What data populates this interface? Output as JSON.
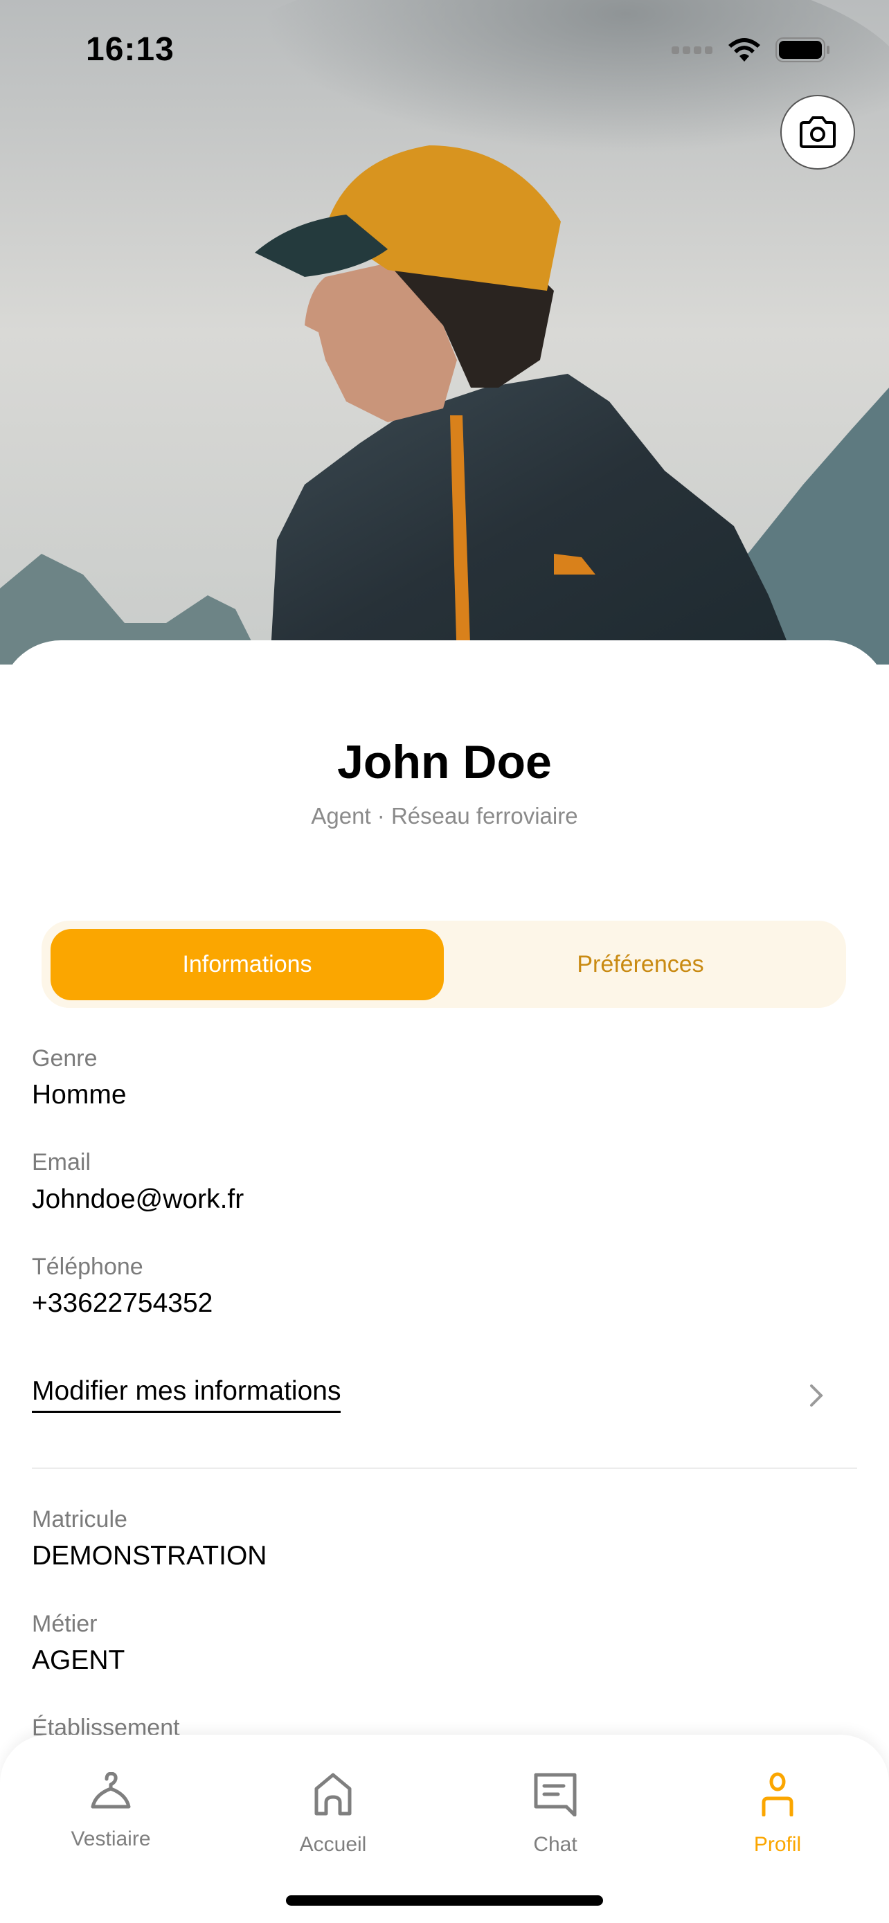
{
  "status_bar": {
    "time": "16:13"
  },
  "header": {
    "photo_alt_icon": "profile-photo",
    "camera_icon": "camera-icon"
  },
  "profile": {
    "name": "John Doe",
    "subtitle": "Agent · Réseau ferroviaire"
  },
  "tabs": [
    {
      "label": "Informations",
      "active": true
    },
    {
      "label": "Préférences",
      "active": false
    }
  ],
  "fields": [
    {
      "label": "Genre",
      "value": "Homme"
    },
    {
      "label": "Email",
      "value": "Johndoe@work.fr"
    },
    {
      "label": "Téléphone",
      "value": "+33622754352"
    }
  ],
  "modify_link": "Modifier mes informations",
  "fields2": [
    {
      "label": "Matricule",
      "value": "DEMONSTRATION"
    },
    {
      "label": "Métier",
      "value": "AGENT"
    },
    {
      "label": "Établissement"
    }
  ],
  "nav": [
    {
      "label": "Vestiaire",
      "icon": "hanger-icon"
    },
    {
      "label": "Accueil",
      "icon": "home-icon"
    },
    {
      "label": "Chat",
      "icon": "chat-icon"
    },
    {
      "label": "Profil",
      "icon": "user-icon",
      "active": true
    }
  ],
  "colors": {
    "accent": "#fba600",
    "accent_light": "#fdf6e8",
    "inactive_tab_text": "#c98a12",
    "muted": "#7f7f7f"
  }
}
